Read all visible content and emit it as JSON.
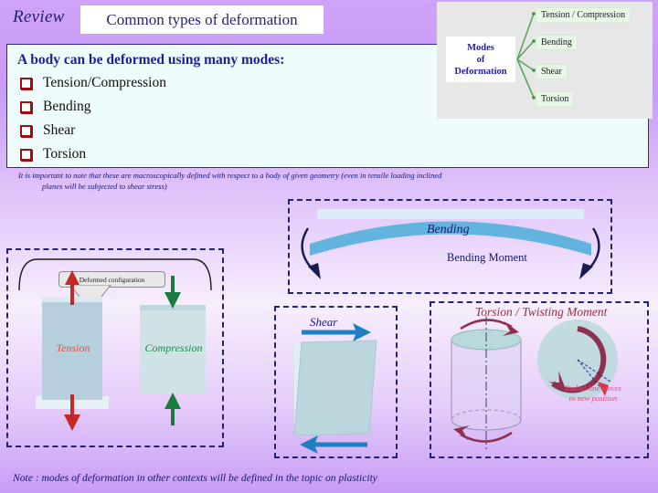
{
  "header": {
    "review_label": "Review",
    "title": "Common types of deformation"
  },
  "content": {
    "lead_line": "A body can be deformed using many modes:",
    "bullets": [
      {
        "label": "Tension/Compression"
      },
      {
        "label": "Bending"
      },
      {
        "label": "Shear"
      },
      {
        "label": "Torsion"
      }
    ]
  },
  "macro_note": {
    "line1": "It is important to note that these are macroscopically defined with respect to a body of given geometry (even in tensile loading inclined",
    "line2": "planes will be subjected to shear stress)"
  },
  "modes_figure": {
    "center_line1": "Modes",
    "center_line2": "of",
    "center_line3": "Deformation",
    "leaves": [
      {
        "label": "Tension / Compression"
      },
      {
        "label": "Bending"
      },
      {
        "label": "Shear"
      },
      {
        "label": "Torsion"
      }
    ]
  },
  "tension_compression": {
    "callout": "Deformed configuration",
    "tension_label": "Tension",
    "compression_label": "Compression"
  },
  "bending": {
    "label": "Bending",
    "moment_label": "Bending Moment"
  },
  "shear": {
    "label": "Shear"
  },
  "torsion": {
    "title": "Torsion / Twisting Moment",
    "radial_note_line1": "Radial line moves",
    "radial_note_line2": "to new position"
  },
  "bottom_note": "Note : modes of deformation in other contexts will be defined in the topic on plasticity",
  "colors": {
    "background_purple": "#c89cf6",
    "panel_fill": "#effcfc",
    "title_text": "#24237e",
    "bullet_marker": "#9d0d10",
    "tension_red": "#e8503c",
    "compression_green": "#1d8a49",
    "bend_blue": "#62b4de",
    "shear_blue": "#1f7fc4",
    "torsion_maroon": "#9e2c3a",
    "radial_pink": "#e2487a",
    "dash_border": "#222277"
  }
}
